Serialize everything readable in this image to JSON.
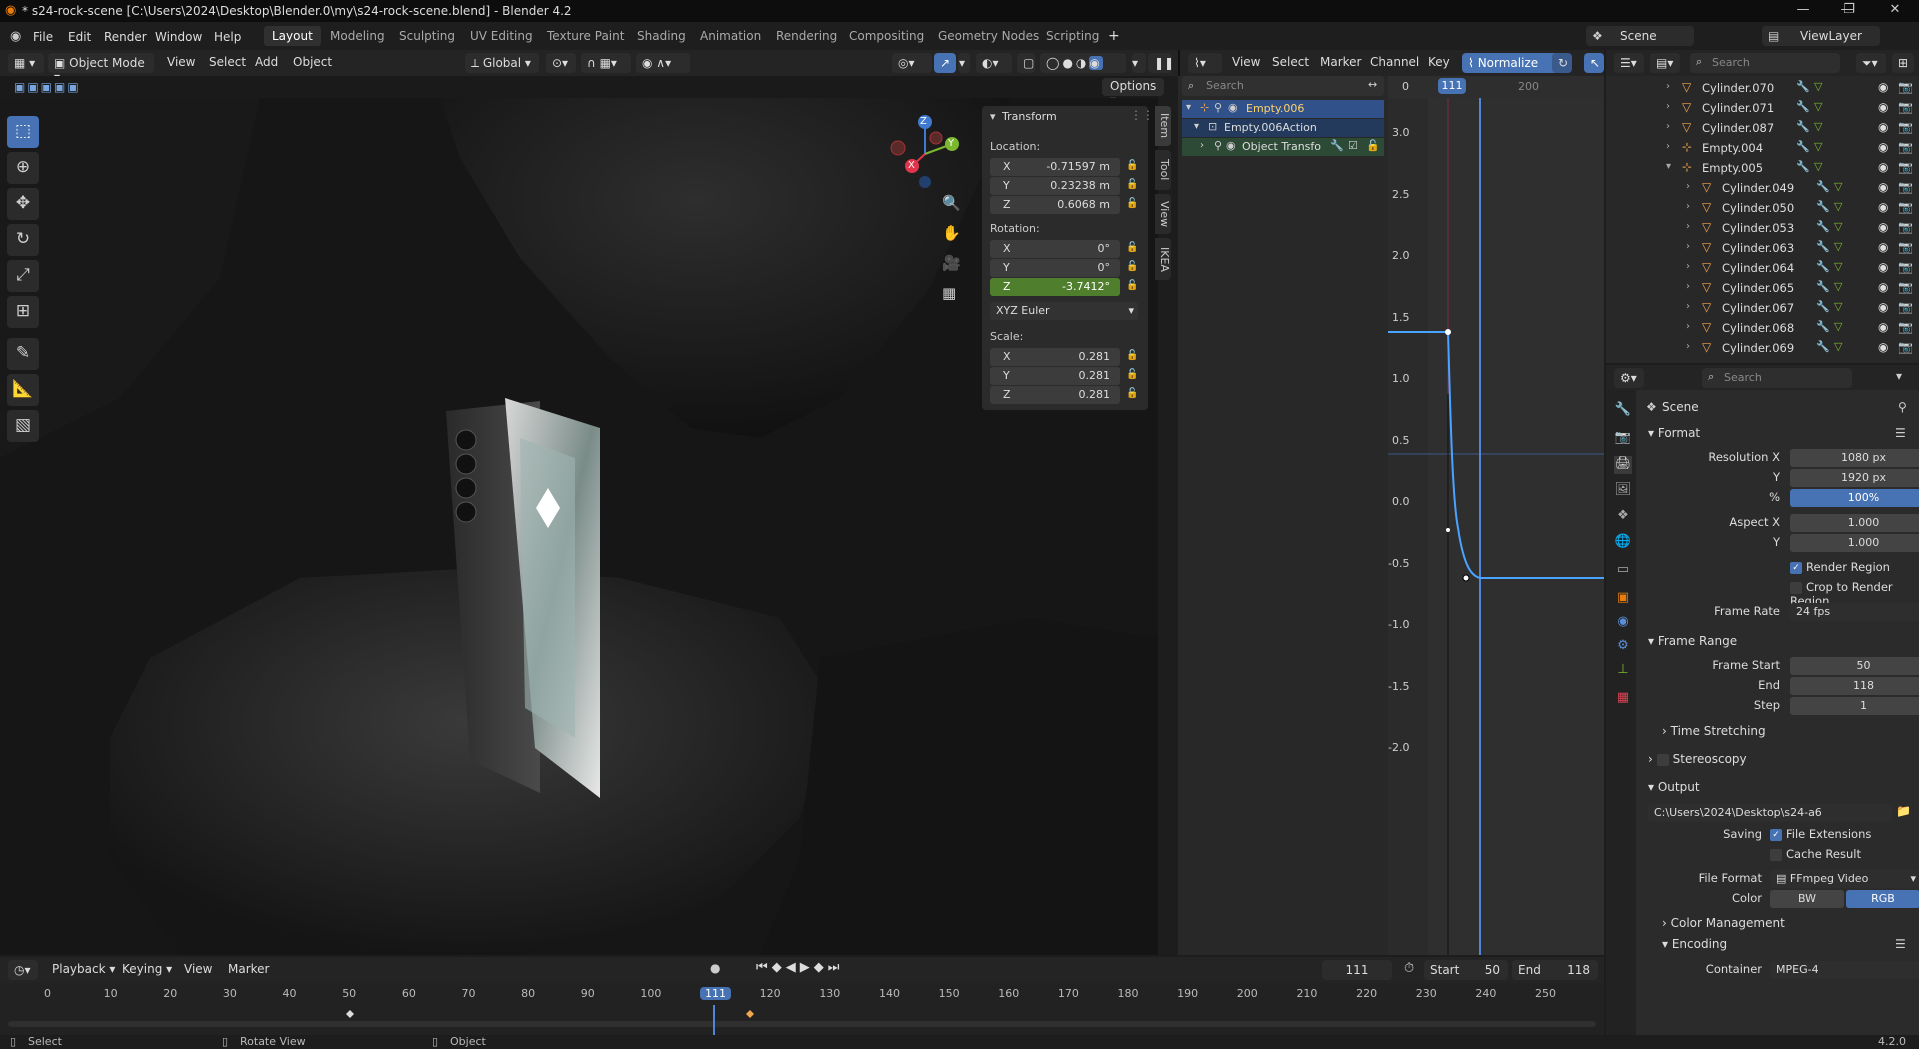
{
  "window": {
    "title": "* s24-rock-scene [C:\\Users\\2024\\Desktop\\Blender.0\\my\\s24-rock-scene.blend] - Blender 4.2",
    "controls": [
      "—",
      "❐",
      "✕"
    ]
  },
  "menu": [
    "File",
    "Edit",
    "Render",
    "Window",
    "Help"
  ],
  "workspaces": [
    "Layout",
    "Modeling",
    "Sculpting",
    "UV Editing",
    "Texture Paint",
    "Shading",
    "Animation",
    "Rendering",
    "Compositing",
    "Geometry Nodes",
    "Scripting"
  ],
  "active_workspace": "Layout",
  "top_right": {
    "scene": "Scene",
    "view_layer": "ViewLayer"
  },
  "viewport": {
    "mode": "Object Mode",
    "menus": [
      "View",
      "Select",
      "Add",
      "Object"
    ],
    "orientation": "Global",
    "options": "Options",
    "tabs": [
      "Item",
      "Tool",
      "View",
      "IKEA"
    ],
    "gizmo": {
      "z": "Z",
      "y": "Y",
      "x": "X"
    },
    "tools": [
      "select-box",
      "cursor",
      "move",
      "rotate",
      "scale",
      "transform",
      "annotate",
      "measure",
      "add-cube"
    ]
  },
  "transform": {
    "title": "Transform",
    "location_label": "Location:",
    "location": [
      {
        "axis": "X",
        "value": "-0.71597 m"
      },
      {
        "axis": "Y",
        "value": "0.23238 m"
      },
      {
        "axis": "Z",
        "value": "0.6068 m"
      }
    ],
    "rotation_label": "Rotation:",
    "rotation": [
      {
        "axis": "X",
        "value": "0°"
      },
      {
        "axis": "Y",
        "value": "0°"
      },
      {
        "axis": "Z",
        "value": "-3.7412°"
      }
    ],
    "rotation_mode": "XYZ Euler",
    "scale_label": "Scale:",
    "scale": [
      {
        "axis": "X",
        "value": "0.281"
      },
      {
        "axis": "Y",
        "value": "0.281"
      },
      {
        "axis": "Z",
        "value": "0.281"
      }
    ]
  },
  "graph_editor": {
    "menus": [
      "View",
      "Select",
      "Marker",
      "Channel",
      "Key"
    ],
    "normalize": "Normalize",
    "search_placeholder": "Search",
    "channels": [
      "Empty.006",
      "Empty.006Action",
      "Object Transfo"
    ],
    "frame_labels": [
      "0",
      "111",
      "200"
    ],
    "current_frame": "111",
    "y_labels": [
      "3.0",
      "2.5",
      "2.0",
      "1.5",
      "1.0",
      "0.5",
      "0.0",
      "-0.5",
      "-1.0",
      "-1.5",
      "-2.0"
    ]
  },
  "outliner": {
    "search_placeholder": "Search",
    "items": [
      {
        "name": "Cylinder.070",
        "type": "mesh",
        "depth": 1
      },
      {
        "name": "Cylinder.071",
        "type": "mesh",
        "depth": 1
      },
      {
        "name": "Cylinder.087",
        "type": "mesh",
        "depth": 1
      },
      {
        "name": "Empty.004",
        "type": "empty",
        "depth": 1
      },
      {
        "name": "Empty.005",
        "type": "empty",
        "depth": 1
      },
      {
        "name": "Cylinder.049",
        "type": "mesh",
        "depth": 2
      },
      {
        "name": "Cylinder.050",
        "type": "mesh",
        "depth": 2
      },
      {
        "name": "Cylinder.053",
        "type": "mesh",
        "depth": 2
      },
      {
        "name": "Cylinder.063",
        "type": "mesh",
        "depth": 2
      },
      {
        "name": "Cylinder.064",
        "type": "mesh",
        "depth": 2
      },
      {
        "name": "Cylinder.065",
        "type": "mesh",
        "depth": 2
      },
      {
        "name": "Cylinder.067",
        "type": "mesh",
        "depth": 2
      },
      {
        "name": "Cylinder.068",
        "type": "mesh",
        "depth": 2
      },
      {
        "name": "Cylinder.069",
        "type": "mesh",
        "depth": 2
      }
    ]
  },
  "properties": {
    "search_placeholder": "Search",
    "context": "Scene",
    "format": {
      "title": "Format",
      "resolution_x_label": "Resolution X",
      "resolution_x": "1080 px",
      "y_label": "Y",
      "resolution_y": "1920 px",
      "pct_label": "%",
      "pct": "100%",
      "aspect_x_label": "Aspect X",
      "aspect_x": "1.000",
      "aspect_y_label": "Y",
      "aspect_y": "1.000",
      "render_region": "Render Region",
      "crop": "Crop to Render Region",
      "frame_rate_label": "Frame Rate",
      "frame_rate": "24 fps"
    },
    "frame_range": {
      "title": "Frame Range",
      "start_label": "Frame Start",
      "start": "50",
      "end_label": "End",
      "end": "118",
      "step_label": "Step",
      "step": "1"
    },
    "time_stretching": "Time Stretching",
    "stereoscopy": "Stereoscopy",
    "output": {
      "title": "Output",
      "path": "C:\\Users\\2024\\Desktop\\s24-a6",
      "saving_label": "Saving",
      "file_extensions": "File Extensions",
      "cache_result": "Cache Result",
      "file_format_label": "File Format",
      "file_format": "FFmpeg Video",
      "color_label": "Color",
      "color_bw": "BW",
      "color_rgb": "RGB"
    },
    "color_management": "Color Management",
    "encoding": {
      "title": "Encoding",
      "container_label": "Container",
      "container": "MPEG-4"
    }
  },
  "timeline": {
    "menus": [
      "Playback",
      "Keying",
      "View",
      "Marker"
    ],
    "current_frame": "111",
    "start_label": "Start",
    "start": "50",
    "end_label": "End",
    "end": "118",
    "ruler": [
      "0",
      "10",
      "20",
      "30",
      "40",
      "50",
      "60",
      "70",
      "80",
      "90",
      "100",
      "111",
      "120",
      "130",
      "140",
      "150",
      "160",
      "170",
      "180",
      "190",
      "200",
      "210",
      "220",
      "230",
      "240",
      "250"
    ]
  },
  "status": {
    "select": "Select",
    "rotate": "Rotate View",
    "object": "Object",
    "version": "4.2.0"
  }
}
